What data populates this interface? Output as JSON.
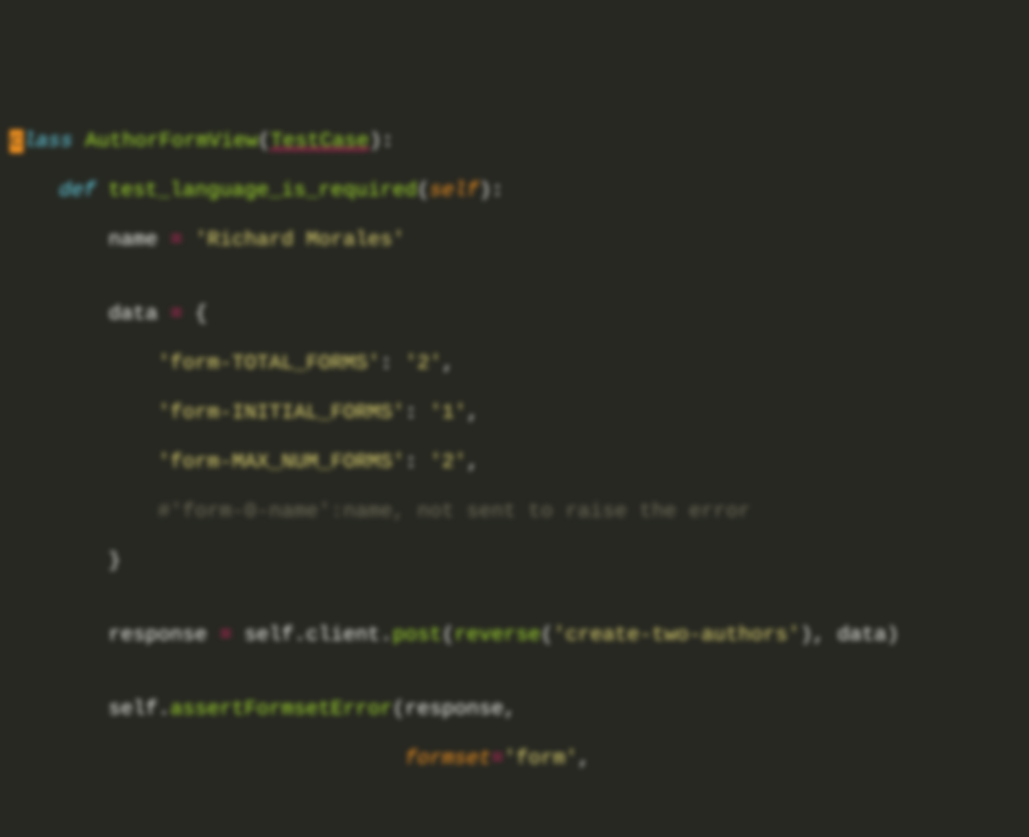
{
  "code": {
    "line1": {
      "cursorChar": "c",
      "kw_rest": "lass",
      "sp": " ",
      "className": "AuthorFormView",
      "open": "(",
      "base": "TestCase",
      "close": "):"
    },
    "line2": {
      "indent": "    ",
      "kw": "def",
      "sp": " ",
      "fn": "test_language_is_required",
      "open": "(",
      "param": "self",
      "close": "):"
    },
    "line3": {
      "indent": "        ",
      "var": "name",
      "sp1": " ",
      "op": "=",
      "sp2": " ",
      "str": "'Richard Morales'"
    },
    "line4": {
      "blank": ""
    },
    "line5": {
      "indent": "        ",
      "var": "data",
      "sp1": " ",
      "op": "=",
      "sp2": " ",
      "brace": "{"
    },
    "line6": {
      "indent": "            ",
      "key": "'form-TOTAL_FORMS'",
      "colon": ":",
      "sp": " ",
      "val": "'2'",
      "comma": ","
    },
    "line7": {
      "indent": "            ",
      "key": "'form-INITIAL_FORMS'",
      "colon": ":",
      "sp": " ",
      "val": "'1'",
      "comma": ","
    },
    "line8": {
      "indent": "            ",
      "key": "'form-MAX_NUM_FORMS'",
      "colon": ":",
      "sp": " ",
      "val": "'2'",
      "comma": ","
    },
    "line9": {
      "indent": "            ",
      "comment": "#'form-0-name':name, not sent to raise the error"
    },
    "line10": {
      "indent": "        ",
      "brace": "}"
    },
    "line11": {
      "blank": ""
    },
    "line12": {
      "indent": "        ",
      "var": "response",
      "sp1": " ",
      "op": "=",
      "sp2": " ",
      "self": "self",
      "dot1": ".",
      "attr1": "client",
      "dot2": ".",
      "meth": "post",
      "open": "(",
      "rev": "reverse",
      "open2": "(",
      "revarg": "'create-two-authors'",
      "close2": ")",
      "comma": ",",
      "sp3": " ",
      "dataArg": "data",
      "close": ")"
    },
    "line13": {
      "blank": ""
    },
    "line14": {
      "indent": "        ",
      "self": "self",
      "dot": ".",
      "meth": "assertFormsetError",
      "open": "(",
      "arg": "response",
      "comma": ","
    },
    "line15": {
      "indent": "                                ",
      "kw": "formset",
      "eq": "=",
      "val": "'form'",
      "comma": ","
    }
  }
}
